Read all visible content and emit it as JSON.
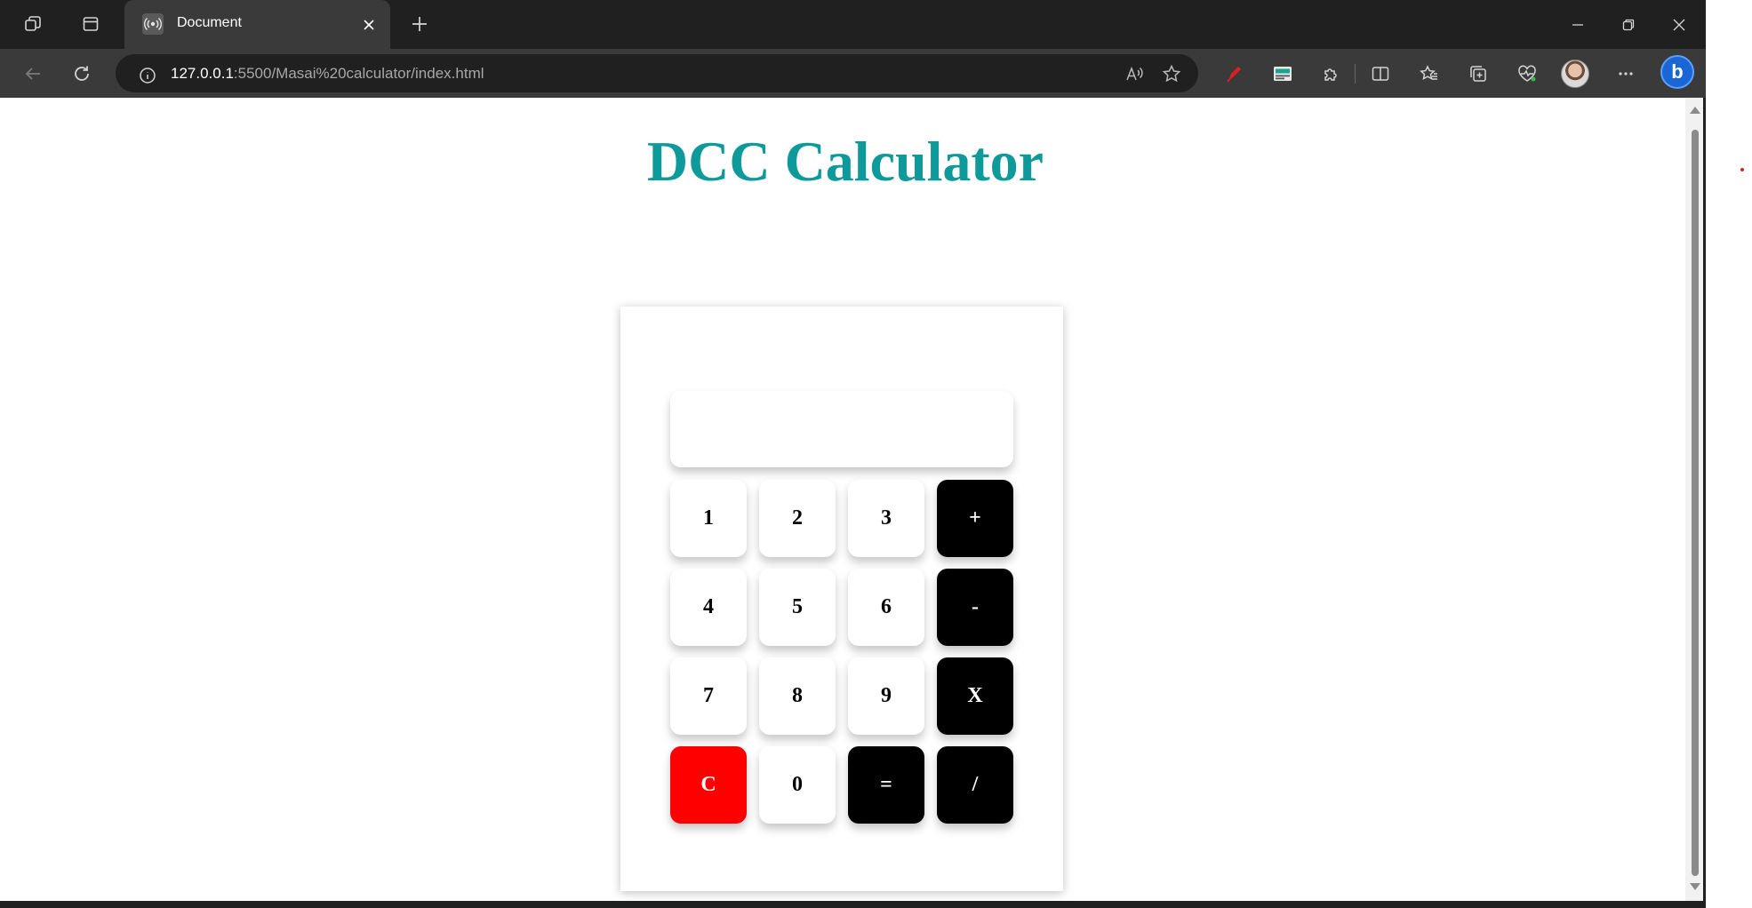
{
  "browser": {
    "tab_title": "Document",
    "url_host": "127.0.0.1",
    "url_path": ":5500/Masai%20calculator/index.html",
    "theme_color": "#202020"
  },
  "page": {
    "title": "DCC Calculator",
    "title_color": "#0e9a9a"
  },
  "calculator": {
    "display_value": "",
    "keys": [
      {
        "label": "1",
        "kind": "digit"
      },
      {
        "label": "2",
        "kind": "digit"
      },
      {
        "label": "3",
        "kind": "digit"
      },
      {
        "label": "+",
        "kind": "operator"
      },
      {
        "label": "4",
        "kind": "digit"
      },
      {
        "label": "5",
        "kind": "digit"
      },
      {
        "label": "6",
        "kind": "digit"
      },
      {
        "label": "-",
        "kind": "operator"
      },
      {
        "label": "7",
        "kind": "digit"
      },
      {
        "label": "8",
        "kind": "digit"
      },
      {
        "label": "9",
        "kind": "digit"
      },
      {
        "label": "X",
        "kind": "operator"
      },
      {
        "label": "C",
        "kind": "clear"
      },
      {
        "label": "0",
        "kind": "digit"
      },
      {
        "label": "=",
        "kind": "operator"
      },
      {
        "label": "/",
        "kind": "operator"
      }
    ],
    "colors": {
      "operator": "#000000",
      "clear": "#ff0000",
      "digit": "#ffffff"
    }
  }
}
